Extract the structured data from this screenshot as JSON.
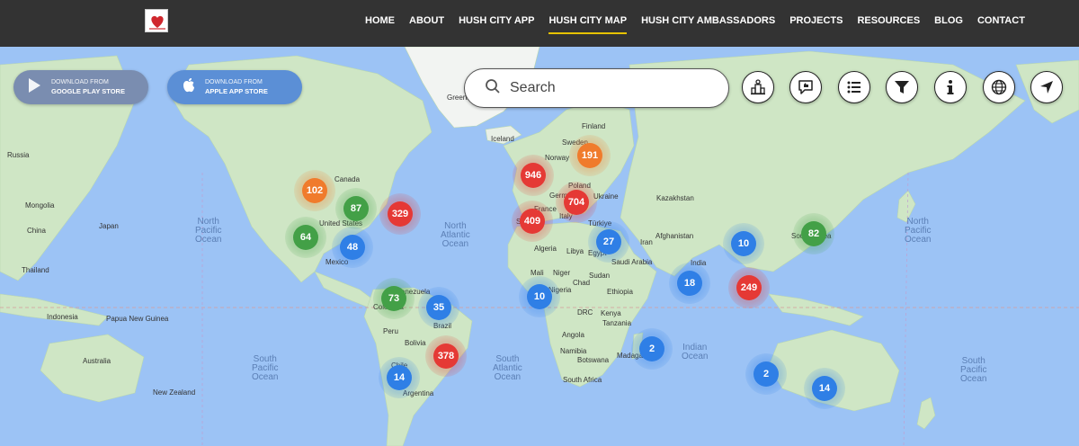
{
  "nav": {
    "items": [
      {
        "label": "HOME",
        "active": false
      },
      {
        "label": "ABOUT",
        "active": false
      },
      {
        "label": "HUSH CITY APP",
        "active": false
      },
      {
        "label": "HUSH CITY MAP",
        "active": true
      },
      {
        "label": "HUSH CITY AMBASSADORS",
        "active": false
      },
      {
        "label": "PROJECTS",
        "active": false
      },
      {
        "label": "RESOURCES",
        "active": false
      },
      {
        "label": "BLOG",
        "active": false
      },
      {
        "label": "CONTACT",
        "active": false
      }
    ]
  },
  "stores": {
    "google": {
      "small": "DOWNLOAD FROM",
      "big": "GOOGLE PLAY STORE",
      "color": "#7a8db0"
    },
    "apple": {
      "small": "DOWNLOAD FROM",
      "big": "APPLE APP STORE",
      "color": "#5b8fd6"
    }
  },
  "search": {
    "placeholder": "Search"
  },
  "tools": [
    "city-icon",
    "feedback-icon",
    "list-icon",
    "filter-icon",
    "info-icon",
    "globe-icon",
    "navigate-icon"
  ],
  "colors": {
    "red": "#e53935",
    "orange": "#f07b2c",
    "green": "#43a047",
    "blue": "#2f7fe6",
    "land": "#cfe6c5",
    "ocean": "#9cc3f5"
  },
  "clusters": [
    {
      "count": "102",
      "color": "orange"
    },
    {
      "count": "87",
      "color": "green"
    },
    {
      "count": "329",
      "color": "red"
    },
    {
      "count": "64",
      "color": "green"
    },
    {
      "count": "48",
      "color": "blue"
    },
    {
      "count": "946",
      "color": "red"
    },
    {
      "count": "191",
      "color": "orange"
    },
    {
      "count": "704",
      "color": "red"
    },
    {
      "count": "409",
      "color": "red"
    },
    {
      "count": "27",
      "color": "blue"
    },
    {
      "count": "10",
      "color": "blue"
    },
    {
      "count": "82",
      "color": "green"
    },
    {
      "count": "18",
      "color": "blue"
    },
    {
      "count": "249",
      "color": "red"
    },
    {
      "count": "73",
      "color": "green"
    },
    {
      "count": "35",
      "color": "blue"
    },
    {
      "count": "10",
      "color": "blue"
    },
    {
      "count": "378",
      "color": "red"
    },
    {
      "count": "14",
      "color": "blue"
    },
    {
      "count": "2",
      "color": "blue"
    },
    {
      "count": "2",
      "color": "blue"
    },
    {
      "count": "14",
      "color": "blue"
    }
  ],
  "places": [
    "Russia",
    "Canada",
    "Mongolia",
    "China",
    "Japan",
    "United States",
    "Mexico",
    "Thailand",
    "Indonesia",
    "Papua New Guinea",
    "Australia",
    "New Zealand",
    "Greenland",
    "Iceland",
    "Finland",
    "Sweden",
    "Norway",
    "Poland",
    "Germany",
    "Ukraine",
    "France",
    "Spain",
    "Italy",
    "Kazakhstan",
    "Türkiye",
    "Iran",
    "Afghanistan",
    "Egypt",
    "Algeria",
    "Libya",
    "Saudi Arabia",
    "Mali",
    "Niger",
    "Sudan",
    "Chad",
    "Nigeria",
    "Ethiopia",
    "Kenya",
    "DRC",
    "Tanzania",
    "Angola",
    "Namibia",
    "Botswana",
    "South Africa",
    "Madagascar",
    "India",
    "South Korea",
    "Venezuela",
    "Colombia",
    "Peru",
    "Brazil",
    "Bolivia",
    "Chile",
    "Argentina"
  ],
  "oceans": [
    "North\nPacific\nOcean",
    "North\nAtlantic\nOcean",
    "South\nPacific\nOcean",
    "South\nAtlantic\nOcean",
    "Indian\nOcean",
    "North\nPacific\nOcean",
    "South\nPacific\nOcean"
  ]
}
